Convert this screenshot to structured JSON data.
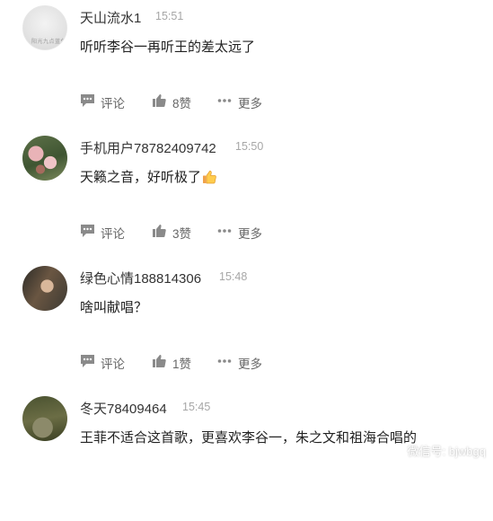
{
  "comments": [
    {
      "username": "天山流水1",
      "time": "15:51",
      "text": "听听李谷一再听王的差太远了",
      "avatar_text": "阳光九点蓝色",
      "actions": {
        "comment": "评论",
        "likes": "8赞",
        "more": "更多"
      }
    },
    {
      "username": "手机用户78782409742",
      "time": "15:50",
      "text": "天籁之音，好听极了",
      "emoji": "thumbs-up",
      "actions": {
        "comment": "评论",
        "likes": "3赞",
        "more": "更多"
      }
    },
    {
      "username": "绿色心情188814306",
      "time": "15:48",
      "text": "啥叫献唱？",
      "actions": {
        "comment": "评论",
        "likes": "1赞",
        "more": "更多"
      }
    },
    {
      "username": "冬天78409464",
      "time": "15:45",
      "text": "王菲不适合这首歌，更喜欢李谷一，朱之文和祖海合唱的"
    }
  ],
  "watermark": {
    "text": "微信号: bjwbgq",
    "icon": "wechat-icon"
  },
  "colors": {
    "username": "#333333",
    "time": "#a7a7a7",
    "action": "#666666",
    "icon": "#8a8a8a"
  }
}
